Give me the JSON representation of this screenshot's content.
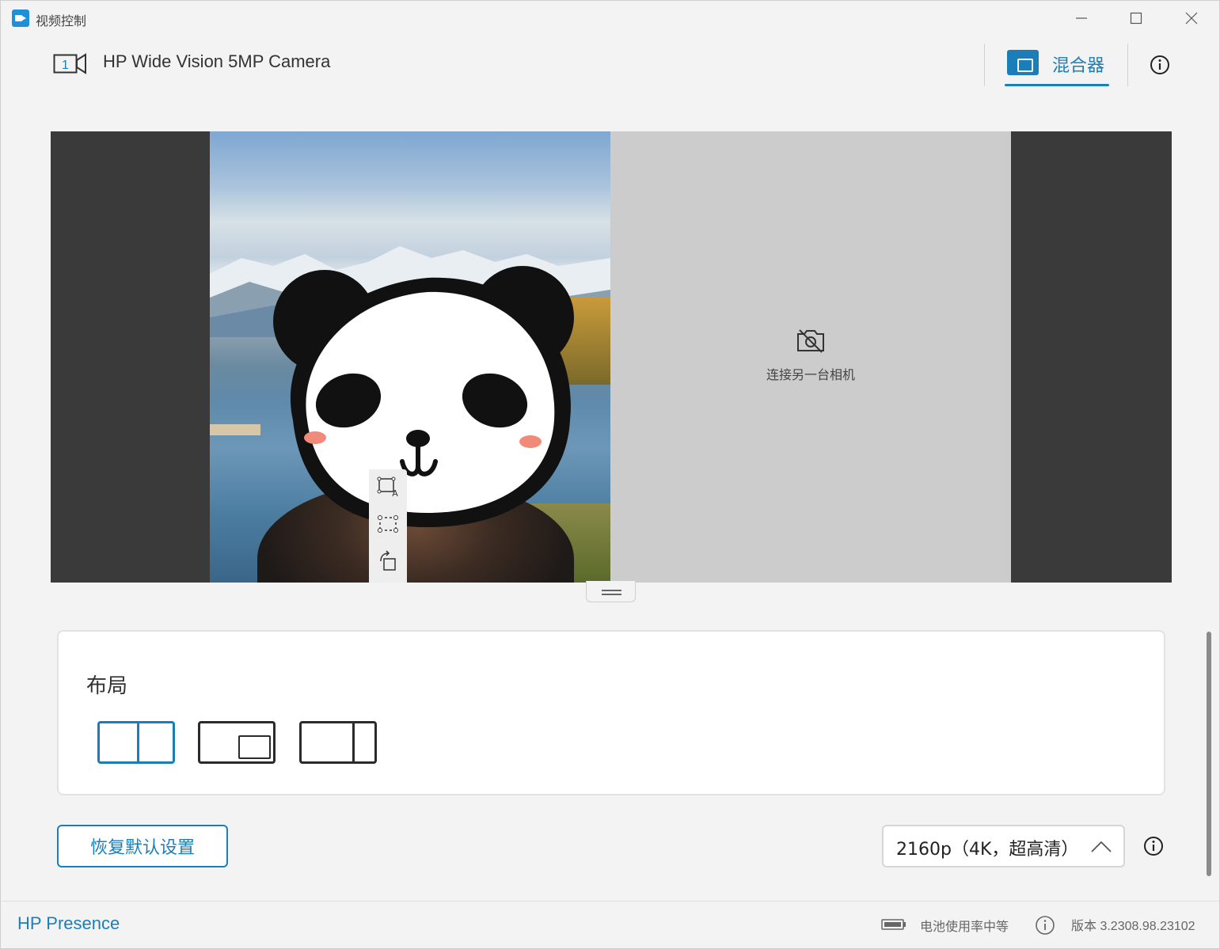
{
  "window": {
    "title": "视频控制"
  },
  "header": {
    "camera_number": "1",
    "camera_name": "HP Wide Vision 5MP Camera",
    "tab_mixer": "混合器"
  },
  "preview": {
    "secondary_placeholder": "连接另一台相机"
  },
  "layout": {
    "title": "布局",
    "options": [
      "split-half",
      "picture-in-picture",
      "split-wide"
    ],
    "selected": "split-half"
  },
  "controls": {
    "reset_label": "恢复默认设置",
    "resolution_value": "2160p（4K，超高清）"
  },
  "footer": {
    "brand": "HP Presence",
    "battery_status": "电池使用率中等",
    "version": "版本 3.2308.98.23102"
  },
  "colors": {
    "accent": "#1a7fb8",
    "preview_bg": "#3a3a3a",
    "placeholder_bg": "#cccccc"
  }
}
